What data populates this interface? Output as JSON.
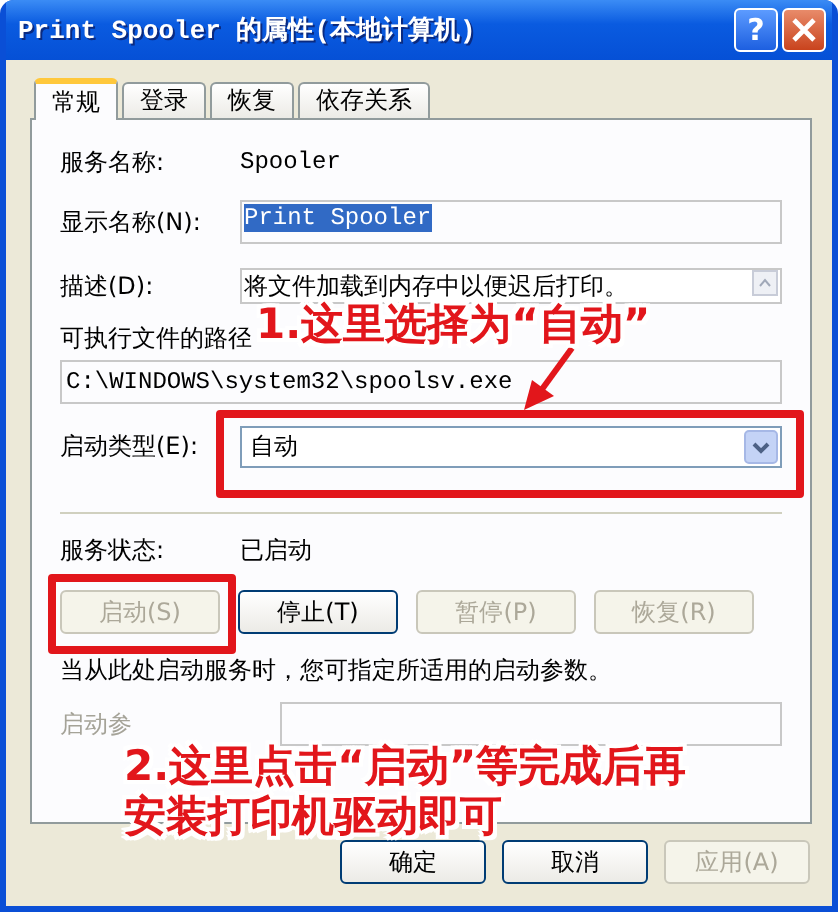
{
  "window": {
    "title": "Print Spooler 的属性(本地计算机)",
    "help_button": "?"
  },
  "tabs": [
    {
      "label": "常规",
      "selected": true
    },
    {
      "label": "登录",
      "selected": false
    },
    {
      "label": "恢复",
      "selected": false
    },
    {
      "label": "依存关系",
      "selected": false
    }
  ],
  "service_name": {
    "label": "服务名称:",
    "value": "Spooler"
  },
  "display_name": {
    "label": "显示名称(N):",
    "value": "Print Spooler",
    "selected": true
  },
  "description": {
    "label": "描述(D):",
    "value": "将文件加载到内存中以便迟后打印。"
  },
  "path": {
    "label": "可执行文件的路径",
    "value": "C:\\WINDOWS\\system32\\spoolsv.exe"
  },
  "startup_type": {
    "label": "启动类型(E):",
    "value": "自动"
  },
  "service_status": {
    "label": "服务状态:",
    "value": "已启动"
  },
  "service_buttons": [
    {
      "label": "启动(S)",
      "disabled": true
    },
    {
      "label": "停止(T)",
      "disabled": false
    },
    {
      "label": "暂停(P)",
      "disabled": true
    },
    {
      "label": "恢复(R)",
      "disabled": true
    }
  ],
  "hint": "当从此处启动服务时，您可指定所适用的启动参数。",
  "start_params": {
    "label": "启动参",
    "disabled": true
  },
  "footer_buttons": [
    {
      "label": "确定",
      "disabled": false
    },
    {
      "label": "取消",
      "disabled": false
    },
    {
      "label": "应用(A)",
      "disabled": true
    }
  ],
  "annotations": [
    {
      "lines": [
        "1.这里选择为“自动”"
      ]
    },
    {
      "lines": [
        "2.这里点击“启动”等完成后再",
        "安装打印机驱动即可"
      ]
    }
  ]
}
